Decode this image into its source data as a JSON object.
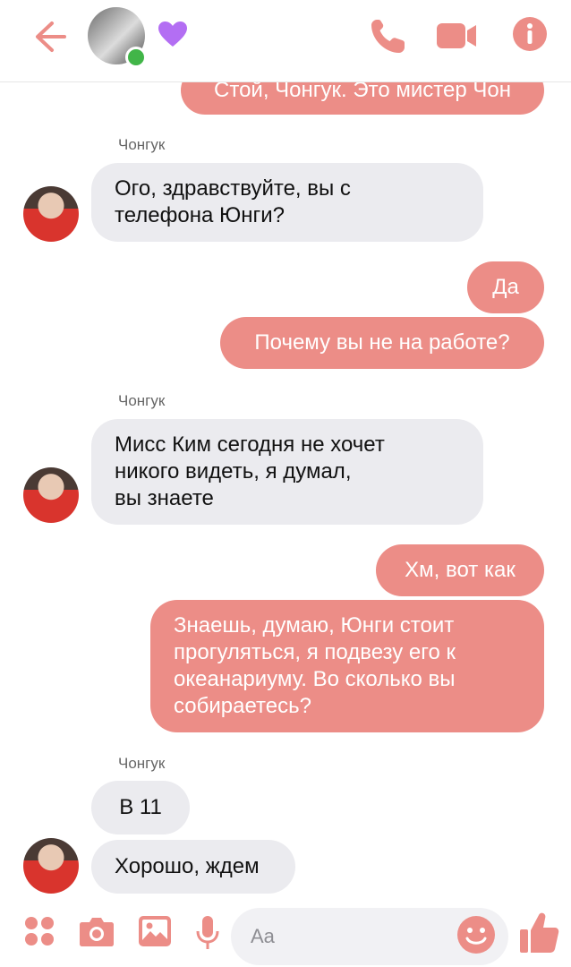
{
  "header": {
    "icons": [
      "back-arrow-icon",
      "avatar",
      "purple-heart-icon",
      "phone-icon",
      "video-camera-icon",
      "info-icon"
    ],
    "accent_color": "#ec8d87",
    "online_color": "#41b548"
  },
  "messages": {
    "m0": "Стой, Чонгук. Это мистер Чон",
    "sender1": "Чонгук",
    "m1": "Ого, здравствуйте, вы с\nтелефона Юнги?",
    "m2": "Да",
    "m3": "Почему вы не на работе?",
    "sender2": "Чонгук",
    "m4": "Мисс Ким сегодня не хочет\nникого видеть, я думал,\nвы знаете",
    "m5": "Хм, вот как",
    "m6": "Знаешь, думаю, Юнги стоит\nпрогуляться, я подвезу его к\nокеанариуму. Во сколько вы\nсобираетесь?",
    "sender3": "Чонгук",
    "m7": "В 11",
    "m8": "Хорошо, ждем"
  },
  "composer": {
    "placeholder": "Aa",
    "icons": [
      "apps-icon",
      "camera-icon",
      "image-icon",
      "microphone-icon",
      "emoji-icon",
      "thumbs-up-icon"
    ]
  },
  "colors": {
    "outgoing_bubble": "#ec8d87",
    "incoming_bubble": "#ebebef"
  }
}
